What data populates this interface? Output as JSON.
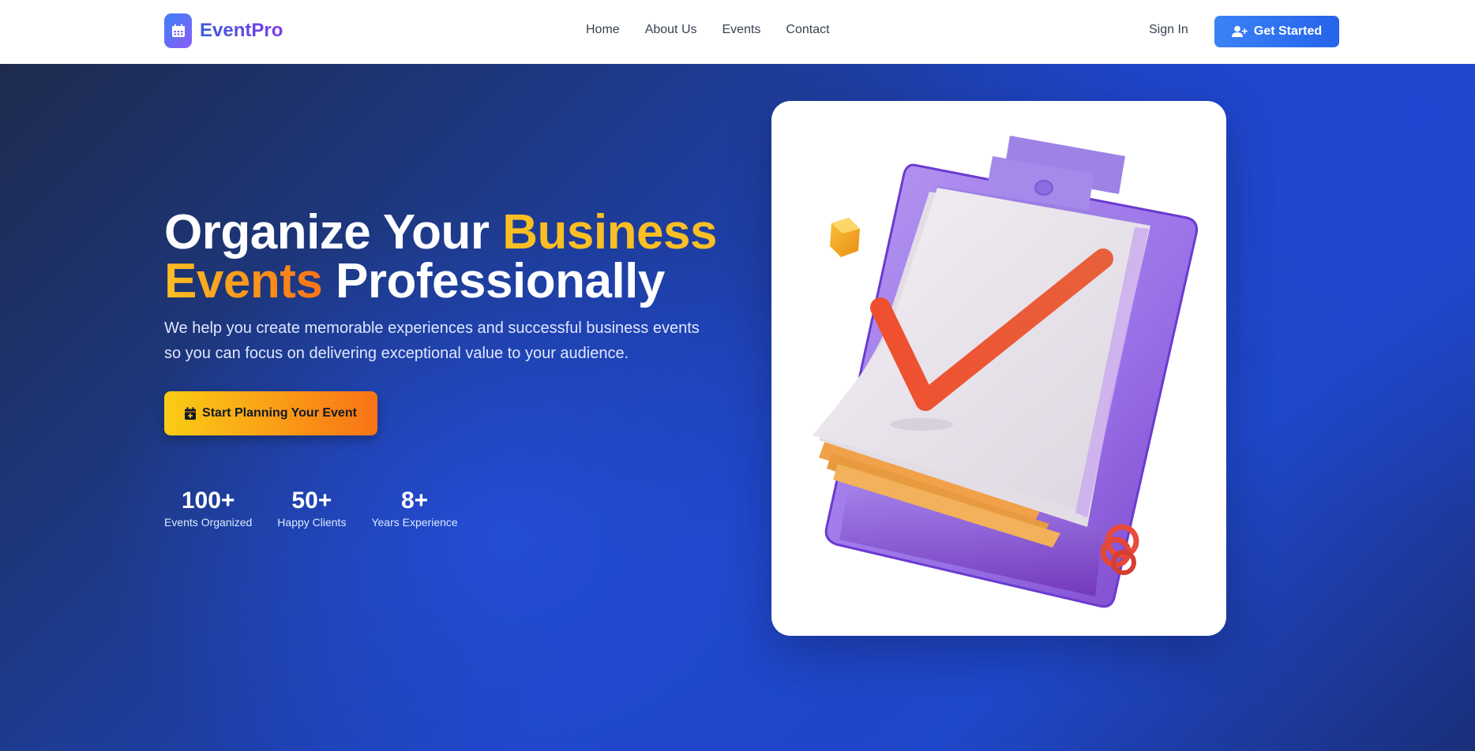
{
  "header": {
    "logo_text": "EventPro",
    "nav": [
      "Home",
      "About Us",
      "Events",
      "Contact"
    ],
    "sign_in": "Sign In",
    "get_started": "Get Started"
  },
  "hero": {
    "title_part1": "Organize Your ",
    "title_highlight1": "Business",
    "title_highlight2": "Events",
    "title_part2": " Professionally",
    "subtitle": "We help you create memorable experiences and successful business events so you can focus on delivering exceptional value to your audience.",
    "cta": "Start Planning Your Event",
    "stats": [
      {
        "value": "100+",
        "label": "Events Organized"
      },
      {
        "value": "50+",
        "label": "Happy Clients"
      },
      {
        "value": "8+",
        "label": "Years Experience"
      }
    ]
  },
  "colors": {
    "primary": "#2563eb",
    "accent_yellow": "#fbbf24",
    "accent_orange": "#f97316",
    "logo_gradient_start": "#3b82f6",
    "logo_gradient_end": "#8b5cf6"
  },
  "icons": {
    "logo": "calendar-icon",
    "get_started": "user-plus-icon",
    "cta": "calendar-plus-icon"
  }
}
